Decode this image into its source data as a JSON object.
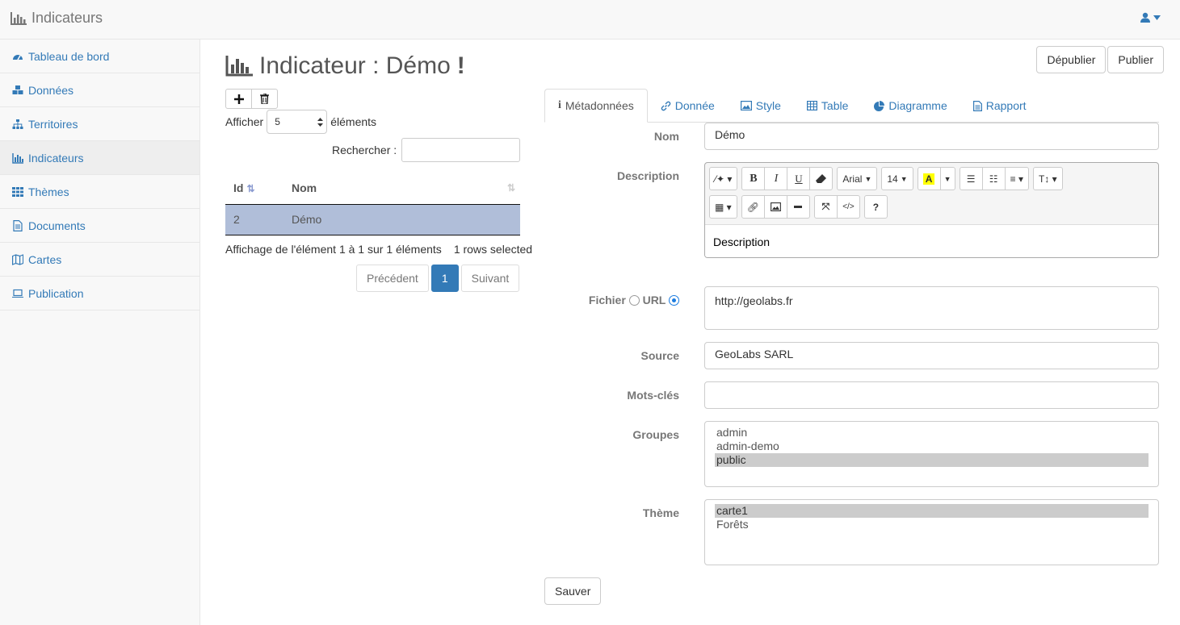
{
  "app": {
    "title": "Indicateurs"
  },
  "sidebar": {
    "items": [
      {
        "label": "Tableau de bord",
        "icon": "dashboard-icon"
      },
      {
        "label": "Données",
        "icon": "cubes-icon"
      },
      {
        "label": "Territoires",
        "icon": "sitemap-icon"
      },
      {
        "label": "Indicateurs",
        "icon": "bar-chart-icon",
        "active": true
      },
      {
        "label": "Thèmes",
        "icon": "th-icon"
      },
      {
        "label": "Documents",
        "icon": "document-icon"
      },
      {
        "label": "Cartes",
        "icon": "map-icon"
      },
      {
        "label": "Publication",
        "icon": "laptop-icon"
      }
    ]
  },
  "page": {
    "title": "Indicateur : Démo",
    "unpublish": "Dépublier",
    "publish": "Publier"
  },
  "table": {
    "show_label": "Afficher",
    "length_value": "5",
    "elements_label": "éléments",
    "search_label": "Rechercher :",
    "columns": [
      "Id",
      "Nom"
    ],
    "rows": [
      [
        "2",
        "Démo"
      ]
    ],
    "info": "Affichage de l'élément 1 à 1 sur 1 éléments",
    "selected": "1 rows selected",
    "prev": "Précédent",
    "page": "1",
    "next": "Suivant"
  },
  "tabs": [
    "Métadonnées",
    "Donnée",
    "Style",
    "Table",
    "Diagramme",
    "Rapport"
  ],
  "form": {
    "nom_label": "Nom",
    "nom_value": "Démo",
    "description_label": "Description",
    "description_value": "Description",
    "editor": {
      "font": "Arial",
      "size": "14"
    },
    "fichier_label": "Fichier",
    "url_label": "URL",
    "url_value": "http://geolabs.fr",
    "source_label": "Source",
    "source_value": "GeoLabs SARL",
    "keywords_label": "Mots-clés",
    "keywords_value": "",
    "groups_label": "Groupes",
    "groups": [
      "admin",
      "admin-demo",
      "public"
    ],
    "groups_selected": "public",
    "theme_label": "Thème",
    "themes": [
      "carte1",
      "Forêts"
    ],
    "theme_selected": "carte1",
    "save": "Sauver"
  }
}
